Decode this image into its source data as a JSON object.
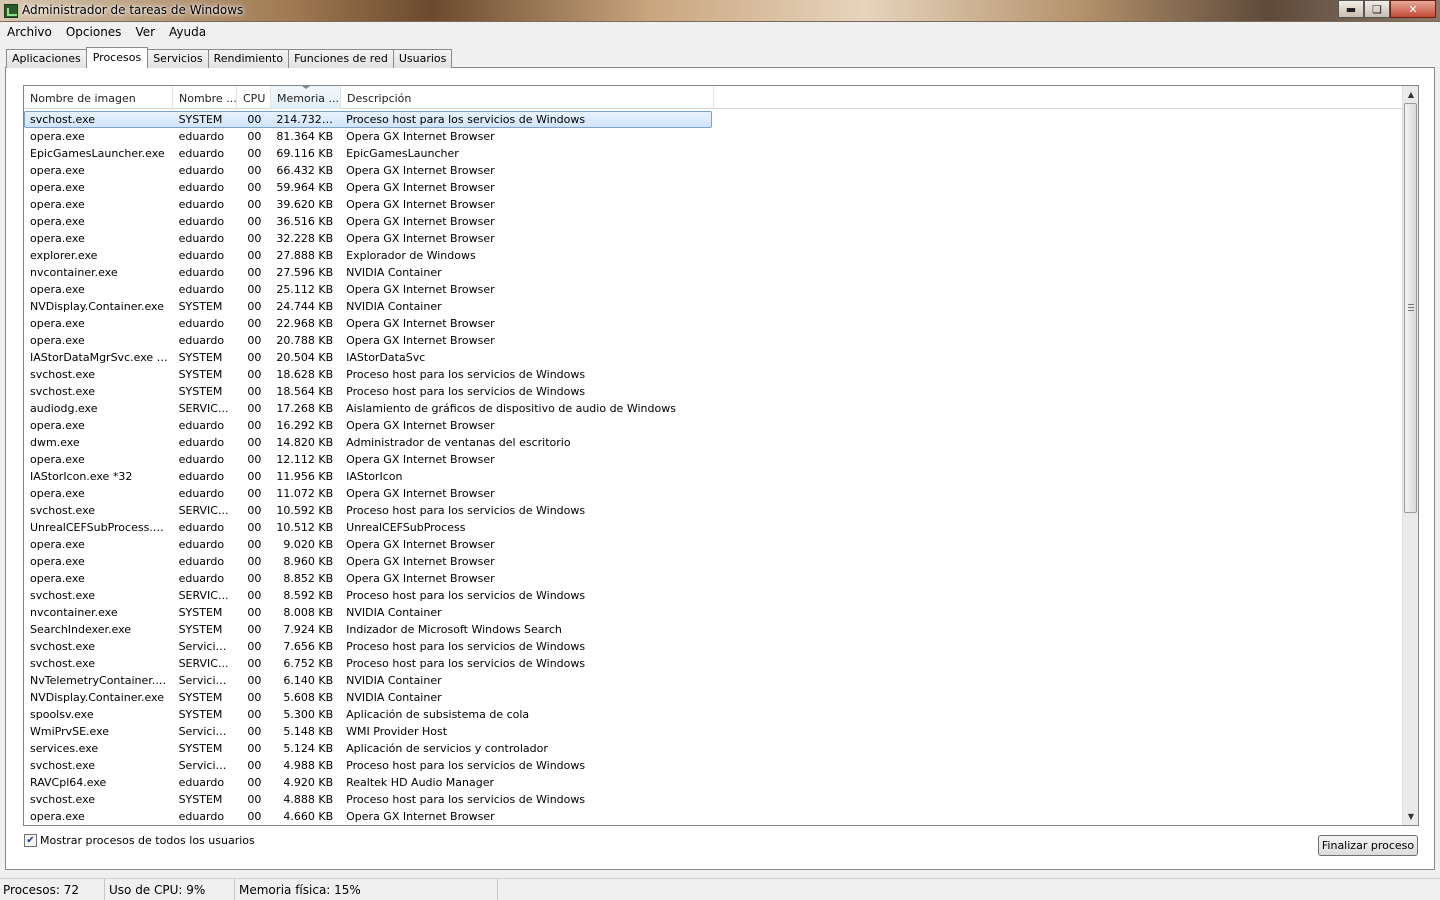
{
  "window": {
    "title": "Administrador de tareas de Windows"
  },
  "menu": [
    "Archivo",
    "Opciones",
    "Ver",
    "Ayuda"
  ],
  "tabs": [
    "Aplicaciones",
    "Procesos",
    "Servicios",
    "Rendimiento",
    "Funciones de red",
    "Usuarios"
  ],
  "active_tab": "Procesos",
  "columns": [
    "Nombre de imagen",
    "Nombre ...",
    "CPU",
    "Memoria ...",
    "Descripción"
  ],
  "processes": [
    {
      "name": "svchost.exe",
      "user": "SYSTEM",
      "cpu": "00",
      "mem": "214.732 KB",
      "desc": "Proceso host para los servicios de Windows"
    },
    {
      "name": "opera.exe",
      "user": "eduardo",
      "cpu": "00",
      "mem": "81.364 KB",
      "desc": "Opera GX Internet Browser"
    },
    {
      "name": "EpicGamesLauncher.exe",
      "user": "eduardo",
      "cpu": "00",
      "mem": "69.116 KB",
      "desc": "EpicGamesLauncher"
    },
    {
      "name": "opera.exe",
      "user": "eduardo",
      "cpu": "00",
      "mem": "66.432 KB",
      "desc": "Opera GX Internet Browser"
    },
    {
      "name": "opera.exe",
      "user": "eduardo",
      "cpu": "00",
      "mem": "59.964 KB",
      "desc": "Opera GX Internet Browser"
    },
    {
      "name": "opera.exe",
      "user": "eduardo",
      "cpu": "00",
      "mem": "39.620 KB",
      "desc": "Opera GX Internet Browser"
    },
    {
      "name": "opera.exe",
      "user": "eduardo",
      "cpu": "00",
      "mem": "36.516 KB",
      "desc": "Opera GX Internet Browser"
    },
    {
      "name": "opera.exe",
      "user": "eduardo",
      "cpu": "00",
      "mem": "32.228 KB",
      "desc": "Opera GX Internet Browser"
    },
    {
      "name": "explorer.exe",
      "user": "eduardo",
      "cpu": "00",
      "mem": "27.888 KB",
      "desc": "Explorador de Windows"
    },
    {
      "name": "nvcontainer.exe",
      "user": "eduardo",
      "cpu": "00",
      "mem": "27.596 KB",
      "desc": "NVIDIA Container"
    },
    {
      "name": "opera.exe",
      "user": "eduardo",
      "cpu": "00",
      "mem": "25.112 KB",
      "desc": "Opera GX Internet Browser"
    },
    {
      "name": "NVDisplay.Container.exe",
      "user": "SYSTEM",
      "cpu": "00",
      "mem": "24.744 KB",
      "desc": "NVIDIA Container"
    },
    {
      "name": "opera.exe",
      "user": "eduardo",
      "cpu": "00",
      "mem": "22.968 KB",
      "desc": "Opera GX Internet Browser"
    },
    {
      "name": "opera.exe",
      "user": "eduardo",
      "cpu": "00",
      "mem": "20.788 KB",
      "desc": "Opera GX Internet Browser"
    },
    {
      "name": "IAStorDataMgrSvc.exe *32",
      "user": "SYSTEM",
      "cpu": "00",
      "mem": "20.504 KB",
      "desc": "IAStorDataSvc"
    },
    {
      "name": "svchost.exe",
      "user": "SYSTEM",
      "cpu": "00",
      "mem": "18.628 KB",
      "desc": "Proceso host para los servicios de Windows"
    },
    {
      "name": "svchost.exe",
      "user": "SYSTEM",
      "cpu": "00",
      "mem": "18.564 KB",
      "desc": "Proceso host para los servicios de Windows"
    },
    {
      "name": "audiodg.exe",
      "user": "SERVIC...",
      "cpu": "00",
      "mem": "17.268 KB",
      "desc": "Aislamiento de gráficos de dispositivo de audio de Windows"
    },
    {
      "name": "opera.exe",
      "user": "eduardo",
      "cpu": "00",
      "mem": "16.292 KB",
      "desc": "Opera GX Internet Browser"
    },
    {
      "name": "dwm.exe",
      "user": "eduardo",
      "cpu": "00",
      "mem": "14.820 KB",
      "desc": "Administrador de ventanas del escritorio"
    },
    {
      "name": "opera.exe",
      "user": "eduardo",
      "cpu": "00",
      "mem": "12.112 KB",
      "desc": "Opera GX Internet Browser"
    },
    {
      "name": "IAStorIcon.exe *32",
      "user": "eduardo",
      "cpu": "00",
      "mem": "11.956 KB",
      "desc": "IAStorIcon"
    },
    {
      "name": "opera.exe",
      "user": "eduardo",
      "cpu": "00",
      "mem": "11.072 KB",
      "desc": "Opera GX Internet Browser"
    },
    {
      "name": "svchost.exe",
      "user": "SERVIC...",
      "cpu": "00",
      "mem": "10.592 KB",
      "desc": "Proceso host para los servicios de Windows"
    },
    {
      "name": "UnrealCEFSubProcess.exe",
      "user": "eduardo",
      "cpu": "00",
      "mem": "10.512 KB",
      "desc": "UnrealCEFSubProcess"
    },
    {
      "name": "opera.exe",
      "user": "eduardo",
      "cpu": "00",
      "mem": "9.020 KB",
      "desc": "Opera GX Internet Browser"
    },
    {
      "name": "opera.exe",
      "user": "eduardo",
      "cpu": "00",
      "mem": "8.960 KB",
      "desc": "Opera GX Internet Browser"
    },
    {
      "name": "opera.exe",
      "user": "eduardo",
      "cpu": "00",
      "mem": "8.852 KB",
      "desc": "Opera GX Internet Browser"
    },
    {
      "name": "svchost.exe",
      "user": "SERVIC...",
      "cpu": "00",
      "mem": "8.592 KB",
      "desc": "Proceso host para los servicios de Windows"
    },
    {
      "name": "nvcontainer.exe",
      "user": "SYSTEM",
      "cpu": "00",
      "mem": "8.008 KB",
      "desc": "NVIDIA Container"
    },
    {
      "name": "SearchIndexer.exe",
      "user": "SYSTEM",
      "cpu": "00",
      "mem": "7.924 KB",
      "desc": "Indizador de Microsoft Windows Search"
    },
    {
      "name": "svchost.exe",
      "user": "Servicio...",
      "cpu": "00",
      "mem": "7.656 KB",
      "desc": "Proceso host para los servicios de Windows"
    },
    {
      "name": "svchost.exe",
      "user": "SERVIC...",
      "cpu": "00",
      "mem": "6.752 KB",
      "desc": "Proceso host para los servicios de Windows"
    },
    {
      "name": "NvTelemetryContainer.ex...",
      "user": "Servicio...",
      "cpu": "00",
      "mem": "6.140 KB",
      "desc": "NVIDIA Container"
    },
    {
      "name": "NVDisplay.Container.exe",
      "user": "SYSTEM",
      "cpu": "00",
      "mem": "5.608 KB",
      "desc": "NVIDIA Container"
    },
    {
      "name": "spoolsv.exe",
      "user": "SYSTEM",
      "cpu": "00",
      "mem": "5.300 KB",
      "desc": "Aplicación de subsistema de cola"
    },
    {
      "name": "WmiPrvSE.exe",
      "user": "Servicio...",
      "cpu": "00",
      "mem": "5.148 KB",
      "desc": "WMI Provider Host"
    },
    {
      "name": "services.exe",
      "user": "SYSTEM",
      "cpu": "00",
      "mem": "5.124 KB",
      "desc": "Aplicación de servicios y controlador"
    },
    {
      "name": "svchost.exe",
      "user": "Servicio...",
      "cpu": "00",
      "mem": "4.988 KB",
      "desc": "Proceso host para los servicios de Windows"
    },
    {
      "name": "RAVCpl64.exe",
      "user": "eduardo",
      "cpu": "00",
      "mem": "4.920 KB",
      "desc": "Realtek HD Audio Manager"
    },
    {
      "name": "svchost.exe",
      "user": "SYSTEM",
      "cpu": "00",
      "mem": "4.888 KB",
      "desc": "Proceso host para los servicios de Windows"
    },
    {
      "name": "opera.exe",
      "user": "eduardo",
      "cpu": "00",
      "mem": "4.660 KB",
      "desc": "Opera GX Internet Browser"
    }
  ],
  "show_all_users": {
    "label": "Mostrar procesos de todos los usuarios",
    "checked": true
  },
  "end_process_button": "Finalizar proceso",
  "status": {
    "processes": "Procesos: 72",
    "cpu": "Uso de CPU: 9%",
    "memory": "Memoria física: 15%"
  }
}
